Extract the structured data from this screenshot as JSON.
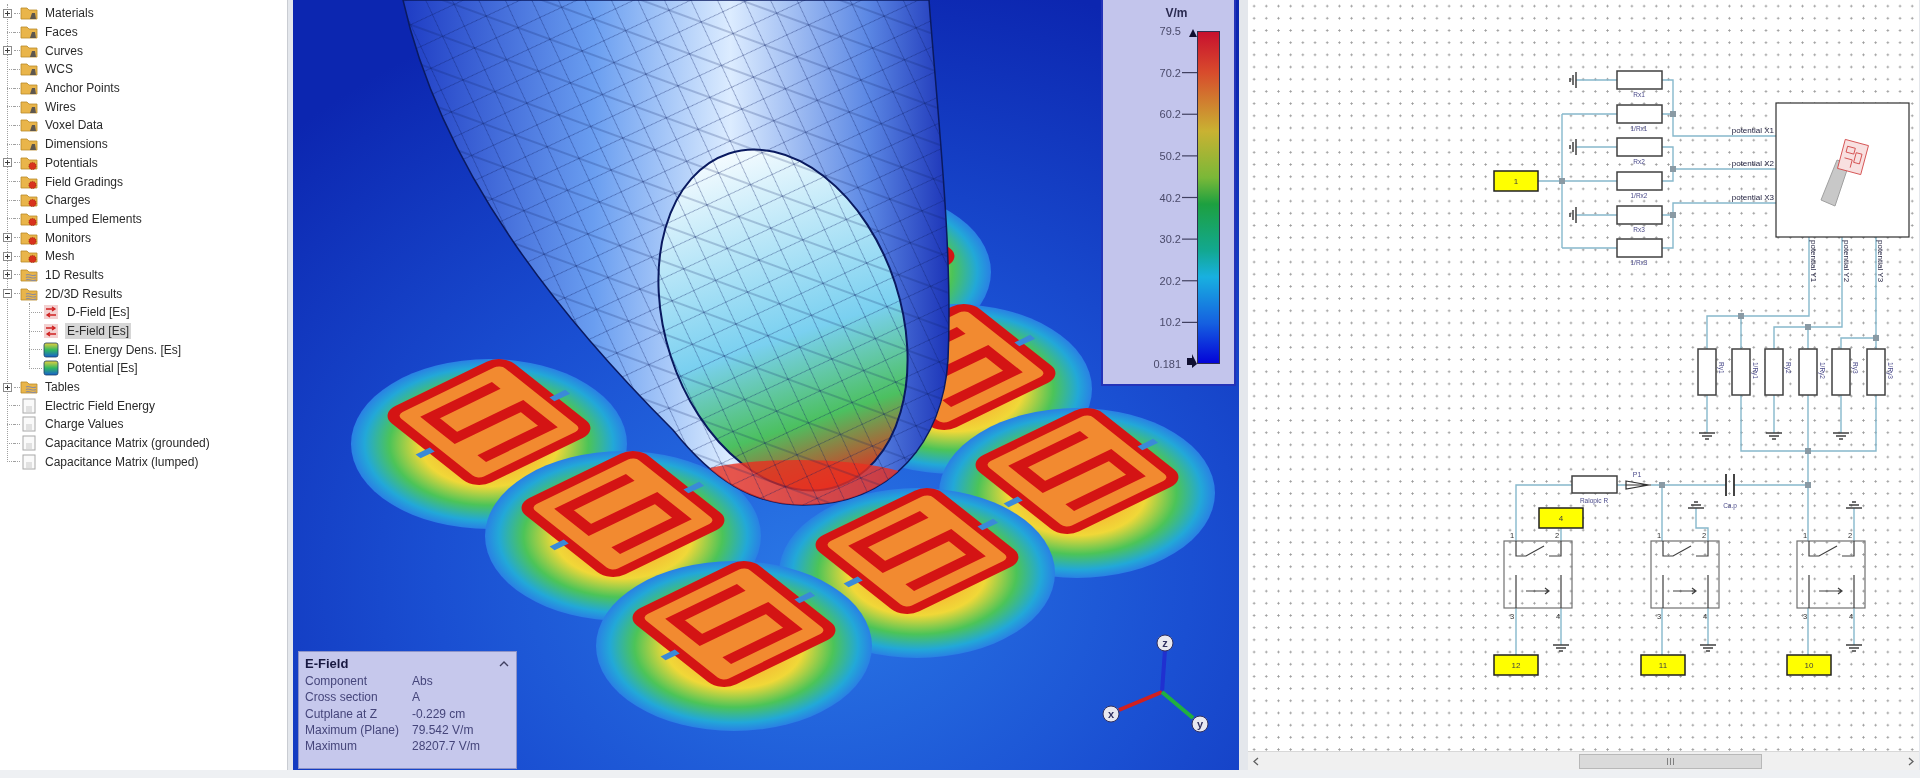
{
  "tree": {
    "items": [
      {
        "label": "Materials",
        "kind": "geometry",
        "expanded": false,
        "selected": false
      },
      {
        "label": "Faces",
        "kind": "geometry",
        "selected": false
      },
      {
        "label": "Curves",
        "kind": "geometry",
        "expanded": false,
        "selected": false
      },
      {
        "label": "WCS",
        "kind": "geometry",
        "selected": false
      },
      {
        "label": "Anchor Points",
        "kind": "geometry",
        "selected": false
      },
      {
        "label": "Wires",
        "kind": "geometry",
        "selected": false
      },
      {
        "label": "Voxel Data",
        "kind": "geometry",
        "selected": false
      },
      {
        "label": "Dimensions",
        "kind": "geometry",
        "selected": false
      },
      {
        "label": "Potentials",
        "kind": "source",
        "expanded": false,
        "selected": false
      },
      {
        "label": "Field Gradings",
        "kind": "source",
        "selected": false
      },
      {
        "label": "Charges",
        "kind": "source",
        "selected": false
      },
      {
        "label": "Lumped Elements",
        "kind": "source",
        "selected": false
      },
      {
        "label": "Monitors",
        "kind": "source",
        "expanded": false,
        "selected": false
      },
      {
        "label": "Mesh",
        "kind": "source",
        "expanded": false,
        "selected": false
      },
      {
        "label": "1D Results",
        "kind": "results",
        "expanded": false,
        "selected": false
      },
      {
        "label": "2D/3D Results",
        "kind": "results",
        "expanded": true,
        "selected": false,
        "children": [
          {
            "label": "D-Field [Es]",
            "kind": "field",
            "selected": false
          },
          {
            "label": "E-Field [Es]",
            "kind": "field",
            "selected": true
          },
          {
            "label": "El. Energy Dens. [Es]",
            "kind": "colormap",
            "selected": false
          },
          {
            "label": "Potential [Es]",
            "kind": "colormap",
            "selected": false
          }
        ]
      },
      {
        "label": "Tables",
        "kind": "results",
        "expanded": false,
        "selected": false
      },
      {
        "label": "Electric Field Energy",
        "kind": "table",
        "selected": false
      },
      {
        "label": "Charge Values",
        "kind": "table",
        "selected": false
      },
      {
        "label": "Capacitance Matrix (grounded)",
        "kind": "table",
        "selected": false
      },
      {
        "label": "Capacitance Matrix (lumped)",
        "kind": "table",
        "selected": false
      }
    ]
  },
  "viewport": {
    "legend": {
      "unit": "V/m",
      "labels": [
        "79.5",
        "70.2",
        "60.2",
        "50.2",
        "40.2",
        "30.2",
        "20.2",
        "10.2",
        "0.181"
      ]
    },
    "info": {
      "title": "E-Field",
      "rows": [
        {
          "label": "Component",
          "value": "Abs"
        },
        {
          "label": "Cross section",
          "value": "A"
        },
        {
          "label": "Cutplane at Z",
          "value": "-0.229 cm"
        },
        {
          "label": "Maximum (Plane)",
          "value": "79.542 V/m"
        },
        {
          "label": "Maximum",
          "value": "28207.7 V/m"
        }
      ]
    },
    "axes": [
      "z",
      "x",
      "y"
    ]
  },
  "schematic": {
    "ports": [
      "1",
      "4",
      "12",
      "11",
      "10"
    ],
    "x_resistors": [
      "Rx1",
      "1/Rx1",
      "Rx2",
      "1/Rx2",
      "Rx3",
      "1/Rx3"
    ],
    "model_outputs": [
      "potential X1",
      "potential X2",
      "potential X3"
    ],
    "model_inputs": [
      "potential Y1",
      "potential Y2",
      "potential Y3"
    ],
    "y_resistors": [
      "Ry1",
      "1/Ry1",
      "Ry2",
      "1/Ry2",
      "Ry3",
      "1/Ry3"
    ],
    "series_resistor": "Ralopic R",
    "probe": "P1",
    "capacitor": "Ca.p",
    "switches": [
      {
        "pins": [
          "1",
          "2",
          "3",
          "4"
        ]
      },
      {
        "pins": [
          "1",
          "2",
          "3",
          "4"
        ]
      },
      {
        "pins": [
          "1",
          "2",
          "3",
          "4"
        ]
      }
    ]
  }
}
